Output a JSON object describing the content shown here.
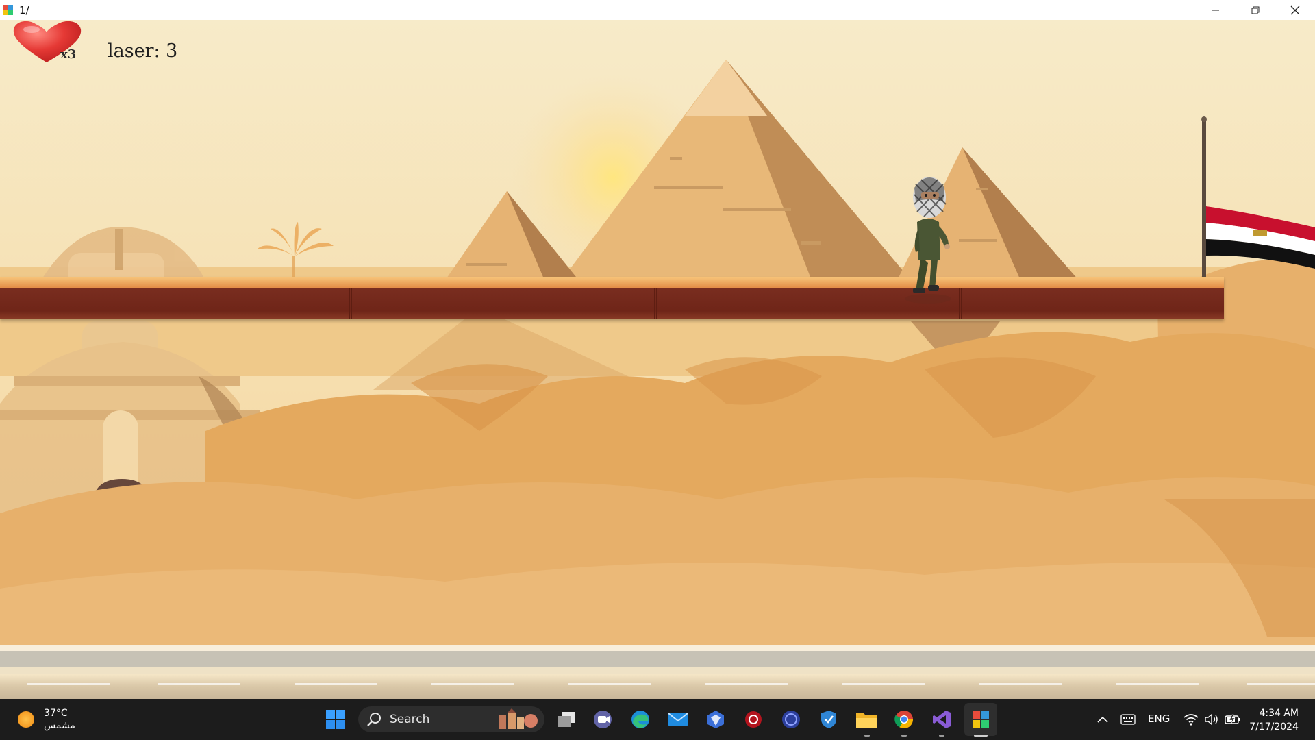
{
  "window": {
    "title": "1/"
  },
  "hud": {
    "lives_count": "x3",
    "laser_label": "laser: 3"
  },
  "taskbar": {
    "weather_temp": "37°C",
    "weather_desc": "مشمس",
    "search_label": "Search",
    "language": "ENG",
    "time": "4:34 AM",
    "date": "7/17/2024",
    "icons": [
      "windows-start-icon",
      "search-icon",
      "task-view-icon",
      "teams-icon",
      "edge-icon",
      "mail-icon",
      "copilot-icon",
      "antivirus-icon",
      "app-icon",
      "defender-icon",
      "file-explorer-icon",
      "chrome-icon",
      "visual-studio-icon",
      "game-app-icon"
    ]
  },
  "colors": {
    "sky": "#f6e6bf",
    "sand": "#e9b06b",
    "platform": "#7a2e20",
    "taskbar": "#1c1c1c"
  }
}
